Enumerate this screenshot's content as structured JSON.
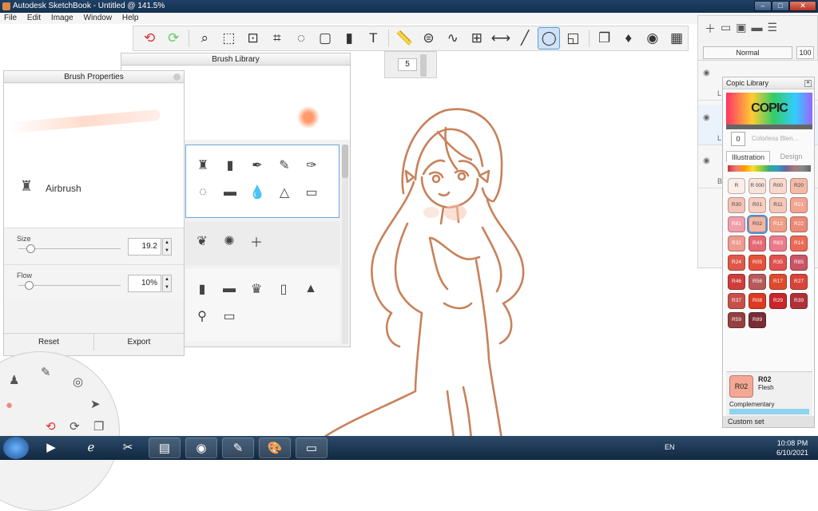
{
  "window": {
    "title": "Autodesk SketchBook - Untitled @ 141.5%",
    "min": "–",
    "max": "□",
    "close": "✕"
  },
  "menu": [
    "File",
    "Edit",
    "Image",
    "Window",
    "Help"
  ],
  "toolbar": {
    "icons": [
      "undo-icon",
      "redo-icon",
      "zoom-icon",
      "select-icon",
      "transform-icon",
      "crop-icon",
      "lasso-icon",
      "perspective-icon",
      "fill-icon",
      "text-icon",
      "ruler-icon",
      "ellipse-icon",
      "curve-icon",
      "grid-icon",
      "symmetry-icon",
      "stroke-icon",
      "brush-icon",
      "shapes-icon"
    ],
    "brush_size": "5"
  },
  "layers": {
    "blend_mode": "Normal",
    "opacity": "100",
    "rows": [
      "L",
      "L",
      "B"
    ]
  },
  "brush_library": {
    "title": "Brush Library"
  },
  "brush_properties": {
    "title": "Brush Properties",
    "brush_name": "Airbrush",
    "size_label": "Size",
    "size_value": "19.2",
    "size_level": 0.12,
    "flow_label": "Flow",
    "flow_value": "10%",
    "flow_level": 0.1,
    "reset": "Reset",
    "export": "Export"
  },
  "copic": {
    "title": "Copic Library",
    "logo": "COPIC",
    "colorless_code": "0",
    "colorless_name": "Colorless Blen...",
    "tab_illustration": "Illustration",
    "tab_design": "Design",
    "swatches": [
      {
        "code": "R 0000",
        "color": "#fbeee8",
        "light": true
      },
      {
        "code": "R 000",
        "color": "#f8e3da",
        "light": true
      },
      {
        "code": "R00",
        "color": "#f8d8cc",
        "light": true
      },
      {
        "code": "R20",
        "color": "#f5b9a8",
        "light": true
      },
      {
        "code": "R30",
        "color": "#f5c2b6",
        "light": true
      },
      {
        "code": "R01",
        "color": "#f7cdc0",
        "light": true
      },
      {
        "code": "R11",
        "color": "#f5c7b7",
        "light": true
      },
      {
        "code": "R21",
        "color": "#f2a592",
        "light": false
      },
      {
        "code": "R81",
        "color": "#ef9fab",
        "light": false
      },
      {
        "code": "R02",
        "color": "#f4b6a4",
        "light": true,
        "selected": true
      },
      {
        "code": "R12",
        "color": "#f09c86",
        "light": false
      },
      {
        "code": "R22",
        "color": "#ec8a78",
        "light": false
      },
      {
        "code": "R32",
        "color": "#ee9a8f",
        "light": false
      },
      {
        "code": "R43",
        "color": "#e56a73",
        "light": false
      },
      {
        "code": "R83",
        "color": "#ea7b8a",
        "light": false
      },
      {
        "code": "R14",
        "color": "#ea6a55",
        "light": false
      },
      {
        "code": "R24",
        "color": "#e0584a",
        "light": false
      },
      {
        "code": "R05",
        "color": "#e5503a",
        "light": false
      },
      {
        "code": "R35",
        "color": "#e0524f",
        "light": false
      },
      {
        "code": "R85",
        "color": "#c95565",
        "light": false
      },
      {
        "code": "R46",
        "color": "#cf3d3d",
        "light": false
      },
      {
        "code": "R56",
        "color": "#b85a5a",
        "light": false
      },
      {
        "code": "R17",
        "color": "#de4a2e",
        "light": false
      },
      {
        "code": "R27",
        "color": "#d9443a",
        "light": false
      },
      {
        "code": "R37",
        "color": "#c8504a",
        "light": false
      },
      {
        "code": "R08",
        "color": "#dc3a22",
        "light": false
      },
      {
        "code": "R29",
        "color": "#c8262a",
        "light": false
      },
      {
        "code": "R39",
        "color": "#b0303a",
        "light": false
      },
      {
        "code": "R59",
        "color": "#954040",
        "light": false
      },
      {
        "code": "R89",
        "color": "#7a2d36",
        "light": false
      }
    ],
    "current_code": "R02",
    "current_name": "Flesh",
    "complementary": "Complementary",
    "custom_set": "Custom set"
  },
  "taskbar": {
    "lang": "EN",
    "time": "10:08 PM",
    "date": "6/10/2021"
  },
  "colors": {
    "line_art": "#c8815a",
    "blush": "#f8c4b0"
  }
}
